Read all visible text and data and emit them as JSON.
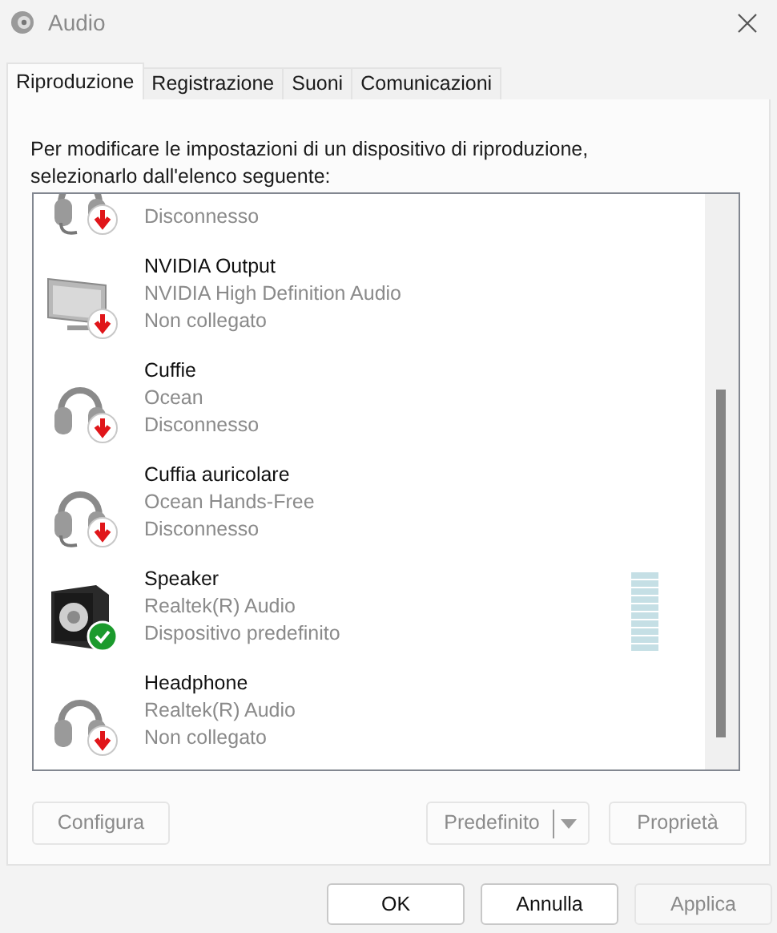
{
  "window": {
    "title": "Audio"
  },
  "tabs": [
    {
      "label": "Riproduzione",
      "selected": true
    },
    {
      "label": "Registrazione",
      "selected": false
    },
    {
      "label": "Suoni",
      "selected": false
    },
    {
      "label": "Comunicazioni",
      "selected": false
    }
  ],
  "instructions": "Per modificare le impostazioni di un dispositivo di riproduzione, selezionarlo dall'elenco seguente:",
  "devices": [
    {
      "kind": "headset",
      "status": "Disconnesso",
      "connected": false,
      "default": false
    },
    {
      "kind": "monitor",
      "name": "NVIDIA Output",
      "description": "NVIDIA High Definition Audio",
      "status": "Non collegato",
      "connected": false,
      "default": false
    },
    {
      "kind": "headphones",
      "name": "Cuffie",
      "description": "Ocean",
      "status": "Disconnesso",
      "connected": false,
      "default": false
    },
    {
      "kind": "headset",
      "name": "Cuffia auricolare",
      "description": "Ocean Hands-Free",
      "status": "Disconnesso",
      "connected": false,
      "default": false
    },
    {
      "kind": "speaker",
      "name": "Speaker",
      "description": "Realtek(R) Audio",
      "status": "Dispositivo predefinito",
      "connected": true,
      "default": true,
      "level": 0
    },
    {
      "kind": "headphones",
      "name": "Headphone",
      "description": "Realtek(R) Audio",
      "status": "Non collegato",
      "connected": false,
      "default": false
    }
  ],
  "panel_buttons": [
    {
      "label": "Configura",
      "disabled": true
    },
    {
      "label": "Predefinito",
      "disabled": true,
      "split": true
    },
    {
      "label": "Proprietà",
      "disabled": true
    }
  ],
  "dialog_buttons": [
    {
      "label": "OK",
      "disabled": false
    },
    {
      "label": "Annulla",
      "disabled": false
    },
    {
      "label": "Applica",
      "disabled": true
    }
  ]
}
